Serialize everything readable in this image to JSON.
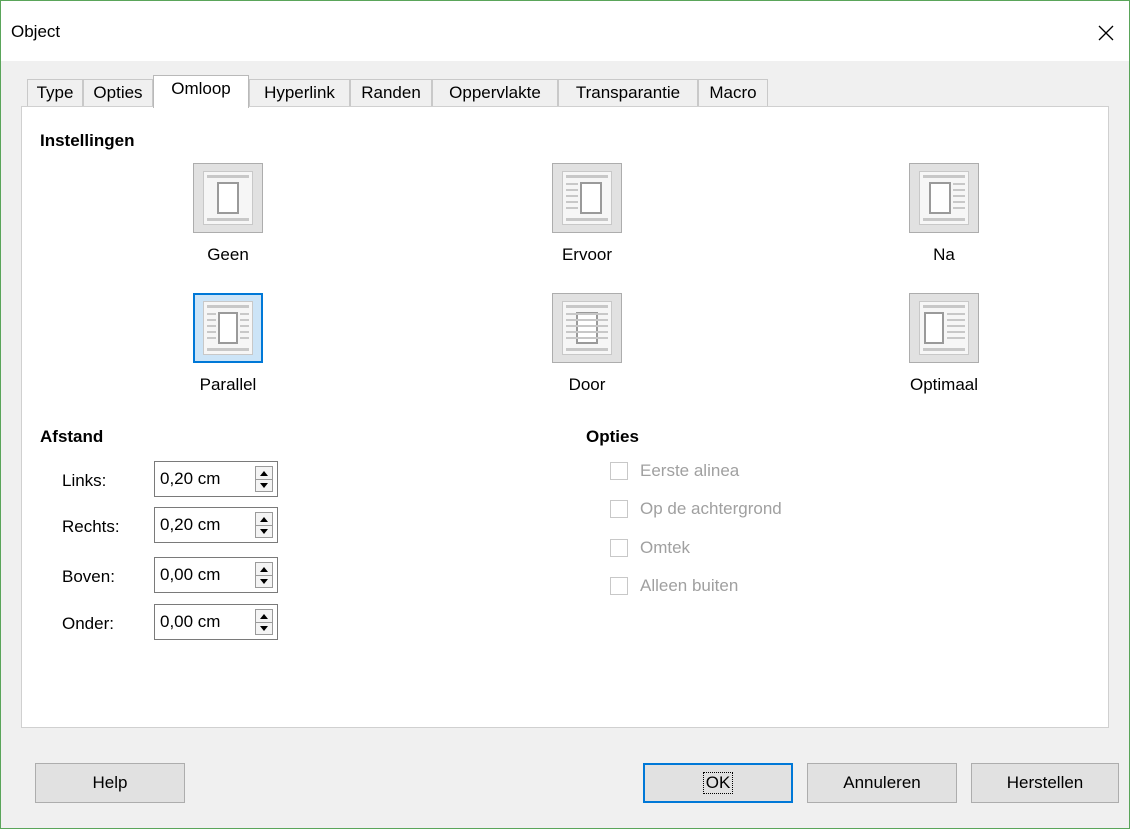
{
  "window": {
    "title": "Object"
  },
  "tabs": [
    {
      "label": "Type",
      "active": false
    },
    {
      "label": "Opties",
      "active": false
    },
    {
      "label": "Omloop",
      "active": true
    },
    {
      "label": "Hyperlink",
      "active": false
    },
    {
      "label": "Randen",
      "active": false
    },
    {
      "label": "Oppervlakte",
      "active": false
    },
    {
      "label": "Transparantie",
      "active": false
    },
    {
      "label": "Macro",
      "active": false
    }
  ],
  "settings": {
    "title": "Instellingen",
    "options": [
      {
        "label": "Geen",
        "mnemonic": "G",
        "selected": false
      },
      {
        "label": "Ervoor",
        "mnemonic": "v",
        "selected": false
      },
      {
        "label": "Na",
        "mnemonic": "N",
        "selected": false
      },
      {
        "label": "Parallel",
        "mnemonic": "P",
        "selected": true
      },
      {
        "label": "Door",
        "mnemonic": "o",
        "selected": false
      },
      {
        "label": "Optimaal",
        "mnemonic": "O",
        "selected": false
      }
    ]
  },
  "spacing": {
    "title": "Afstand",
    "fields": [
      {
        "label": "Links:",
        "value": "0,20 cm"
      },
      {
        "label": "Rechts:",
        "value": "0,20 cm"
      },
      {
        "label": "Boven:",
        "value": "0,00 cm"
      },
      {
        "label": "Onder:",
        "value": "0,00 cm"
      }
    ]
  },
  "options": {
    "title": "Opties",
    "items": [
      {
        "label": "Eerste alinea",
        "checked": false,
        "enabled": false
      },
      {
        "label": "Op de achtergrond",
        "checked": false,
        "enabled": false
      },
      {
        "label": "Omtek",
        "checked": false,
        "enabled": false
      },
      {
        "label": "Alleen buiten",
        "checked": false,
        "enabled": false
      }
    ]
  },
  "buttons": {
    "help": "Help",
    "ok": "OK",
    "cancel": "Annuleren",
    "reset": "Herstellen"
  },
  "colors": {
    "accent": "#0078d7",
    "window_border": "#5aa55a",
    "disabled_text": "#a0a0a0"
  },
  "icons": {
    "close": "close-icon",
    "spin_up": "arrow-up-icon",
    "spin_down": "arrow-down-icon"
  }
}
